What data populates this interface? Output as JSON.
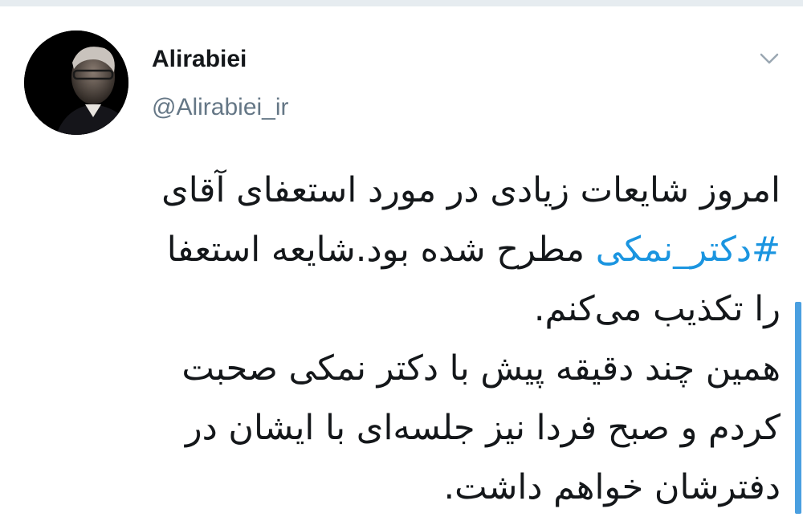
{
  "author": {
    "name": "Alirabiei",
    "handle": "@Alirabiei_ir"
  },
  "tweet": {
    "line1": "امروز شایعات زیادی در مورد استعفای آقای",
    "line2_hashtag": "#دکتر_نمکی",
    "line2_rest": " مطرح شده بود.شایعه استعفا",
    "line3": "را تکذیب می‌کنم.",
    "line4": "همین چند دقیقه پیش با دکتر نمکی صحبت",
    "line5": "کردم و صبح فردا نیز جلسه‌ای با ایشان در",
    "line6": "دفترشان خواهم داشت."
  },
  "icons": {
    "menu": "chevron-down-icon"
  },
  "colors": {
    "hashtag": "#1b95e0",
    "text": "#14171a",
    "secondary": "#657786",
    "scrollbar": "#4a9fe0"
  }
}
